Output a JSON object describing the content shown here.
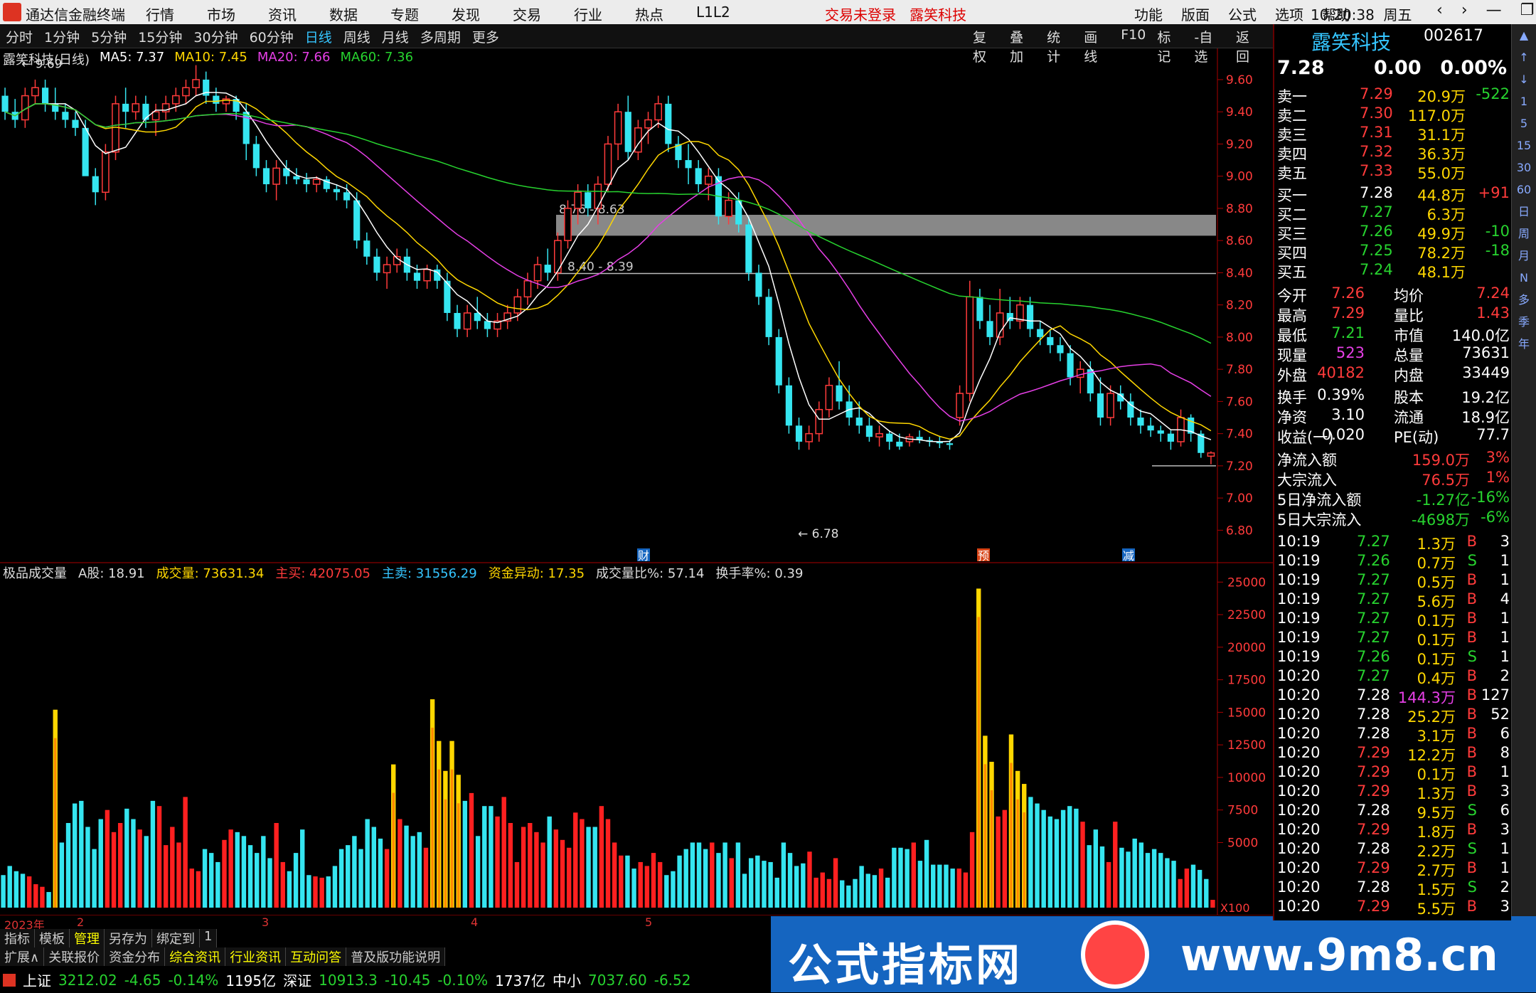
{
  "window": {
    "title": "通达信金融终端",
    "menu": [
      "行情",
      "市场",
      "资讯",
      "数据",
      "专题",
      "发现",
      "交易",
      "行业",
      "热点",
      "L1L2"
    ],
    "login_status": "交易未登录",
    "stock_short": "露笑科技",
    "right_menu": [
      "功能",
      "版面",
      "公式",
      "选项",
      "帮助"
    ],
    "time": "10:20:38",
    "weekday": "周五"
  },
  "toolbar": {
    "periods": [
      "分时",
      "1分钟",
      "5分钟",
      "15分钟",
      "30分钟",
      "60分钟",
      "日线",
      "周线",
      "月线",
      "多周期",
      "更多"
    ],
    "active": "日线",
    "tools": [
      "复权",
      "叠加",
      "统计",
      "画线",
      "F10",
      "标记",
      "-自选",
      "返回"
    ]
  },
  "kline": {
    "title": "露笑科技(日线)",
    "ma": [
      {
        "label": "MA5: 7.37",
        "color": "#ffffff"
      },
      {
        "label": "MA10: 7.45",
        "color": "#ffd700"
      },
      {
        "label": "MA20: 7.66",
        "color": "#e63fe6"
      },
      {
        "label": "MA60: 7.36",
        "color": "#27d32f"
      }
    ],
    "high_label": "9.69",
    "low_label": "6.78",
    "zone_upper_label": "8.76 - 8.63",
    "zone_lower_label": "8.40 - 8.39",
    "markers": [
      "财",
      "预",
      "减"
    ],
    "y_ticks": [
      "9.60",
      "9.40",
      "9.20",
      "9.00",
      "8.80",
      "8.60",
      "8.40",
      "8.20",
      "8.00",
      "7.80",
      "7.60",
      "7.40",
      "7.20",
      "7.00",
      "6.80"
    ]
  },
  "chart_data": [
    {
      "type": "candlestick",
      "title": "露笑科技(日线)",
      "ylim": [
        6.7,
        9.75
      ],
      "ohlc": [
        [
          9.5,
          9.55,
          9.35,
          9.4
        ],
        [
          9.4,
          9.48,
          9.3,
          9.35
        ],
        [
          9.35,
          9.55,
          9.3,
          9.5
        ],
        [
          9.5,
          9.6,
          9.45,
          9.55
        ],
        [
          9.55,
          9.6,
          9.4,
          9.45
        ],
        [
          9.45,
          9.55,
          9.35,
          9.4
        ],
        [
          9.4,
          9.45,
          9.3,
          9.35
        ],
        [
          9.35,
          9.4,
          9.25,
          9.3
        ],
        [
          9.3,
          9.35,
          9.1,
          9.0
        ],
        [
          9.0,
          9.05,
          8.82,
          8.9
        ],
        [
          8.9,
          9.2,
          8.85,
          9.15
        ],
        [
          9.15,
          9.5,
          9.1,
          9.45
        ],
        [
          9.45,
          9.55,
          9.3,
          9.4
        ],
        [
          9.4,
          9.5,
          9.35,
          9.45
        ],
        [
          9.45,
          9.5,
          9.3,
          9.35
        ],
        [
          9.35,
          9.45,
          9.25,
          9.4
        ],
        [
          9.4,
          9.5,
          9.35,
          9.45
        ],
        [
          9.45,
          9.55,
          9.4,
          9.5
        ],
        [
          9.5,
          9.6,
          9.45,
          9.55
        ],
        [
          9.55,
          9.69,
          9.5,
          9.6
        ],
        [
          9.6,
          9.65,
          9.45,
          9.5
        ],
        [
          9.5,
          9.55,
          9.4,
          9.45
        ],
        [
          9.45,
          9.5,
          9.4,
          9.48
        ],
        [
          9.48,
          9.5,
          9.35,
          9.4
        ],
        [
          9.4,
          9.45,
          9.1,
          9.2
        ],
        [
          9.2,
          9.25,
          9.0,
          9.05
        ],
        [
          9.05,
          9.1,
          8.9,
          8.95
        ],
        [
          8.95,
          9.1,
          8.85,
          9.05
        ],
        [
          9.05,
          9.1,
          8.95,
          9.0
        ],
        [
          9.0,
          9.05,
          8.95,
          8.98
        ],
        [
          8.98,
          9.02,
          8.9,
          8.95
        ],
        [
          8.95,
          9.0,
          8.9,
          8.98
        ],
        [
          8.98,
          9.0,
          8.9,
          8.92
        ],
        [
          8.92,
          8.95,
          8.85,
          8.9
        ],
        [
          8.9,
          8.95,
          8.8,
          8.85
        ],
        [
          8.85,
          8.9,
          8.55,
          8.6
        ],
        [
          8.6,
          8.65,
          8.45,
          8.5
        ],
        [
          8.5,
          8.55,
          8.35,
          8.4
        ],
        [
          8.4,
          8.5,
          8.3,
          8.45
        ],
        [
          8.45,
          8.55,
          8.4,
          8.5
        ],
        [
          8.5,
          8.55,
          8.35,
          8.4
        ],
        [
          8.4,
          8.45,
          8.3,
          8.35
        ],
        [
          8.35,
          8.45,
          8.3,
          8.42
        ],
        [
          8.42,
          8.45,
          8.3,
          8.35
        ],
        [
          8.35,
          8.4,
          8.1,
          8.15
        ],
        [
          8.15,
          8.2,
          8.0,
          8.05
        ],
        [
          8.05,
          8.2,
          8.0,
          8.15
        ],
        [
          8.15,
          8.25,
          8.05,
          8.1
        ],
        [
          8.1,
          8.15,
          8.0,
          8.05
        ],
        [
          8.05,
          8.15,
          8.0,
          8.1
        ],
        [
          8.1,
          8.2,
          8.05,
          8.15
        ],
        [
          8.15,
          8.3,
          8.1,
          8.25
        ],
        [
          8.25,
          8.4,
          8.2,
          8.35
        ],
        [
          8.35,
          8.5,
          8.3,
          8.45
        ],
        [
          8.45,
          8.55,
          8.35,
          8.4
        ],
        [
          8.4,
          8.65,
          8.35,
          8.6
        ],
        [
          8.6,
          8.85,
          8.55,
          8.8
        ],
        [
          8.8,
          8.95,
          8.7,
          8.9
        ],
        [
          8.9,
          8.95,
          8.75,
          8.8
        ],
        [
          8.8,
          9.0,
          8.7,
          8.95
        ],
        [
          8.95,
          9.25,
          8.9,
          9.2
        ],
        [
          9.2,
          9.45,
          9.1,
          9.4
        ],
        [
          9.4,
          9.5,
          9.1,
          9.15
        ],
        [
          9.15,
          9.35,
          9.1,
          9.3
        ],
        [
          9.3,
          9.4,
          9.2,
          9.35
        ],
        [
          9.35,
          9.5,
          9.3,
          9.45
        ],
        [
          9.45,
          9.5,
          9.15,
          9.2
        ],
        [
          9.2,
          9.25,
          9.05,
          9.1
        ],
        [
          9.1,
          9.2,
          8.95,
          9.05
        ],
        [
          9.05,
          9.1,
          8.9,
          8.95
        ],
        [
          8.95,
          9.05,
          8.85,
          9.0
        ],
        [
          9.0,
          9.05,
          8.7,
          8.75
        ],
        [
          8.75,
          8.9,
          8.7,
          8.85
        ],
        [
          8.85,
          8.9,
          8.65,
          8.7
        ],
        [
          8.7,
          8.75,
          8.35,
          8.4
        ],
        [
          8.4,
          8.45,
          8.2,
          8.25
        ],
        [
          8.25,
          8.3,
          7.95,
          8.0
        ],
        [
          8.0,
          8.05,
          7.65,
          7.7
        ],
        [
          7.7,
          7.75,
          7.4,
          7.45
        ],
        [
          7.45,
          7.5,
          7.3,
          7.35
        ],
        [
          7.35,
          7.45,
          7.3,
          7.4
        ],
        [
          7.4,
          7.6,
          7.35,
          7.55
        ],
        [
          7.55,
          7.75,
          7.5,
          7.7
        ],
        [
          7.7,
          7.85,
          7.55,
          7.6
        ],
        [
          7.6,
          7.7,
          7.45,
          7.5
        ],
        [
          7.5,
          7.6,
          7.4,
          7.45
        ],
        [
          7.45,
          7.5,
          7.35,
          7.38
        ],
        [
          7.38,
          7.45,
          7.32,
          7.4
        ],
        [
          7.4,
          7.42,
          7.3,
          7.35
        ],
        [
          7.35,
          7.4,
          7.3,
          7.32
        ],
        [
          7.35,
          7.4,
          7.32,
          7.38
        ],
        [
          7.38,
          7.42,
          7.34,
          7.36
        ],
        [
          7.36,
          7.38,
          7.32,
          7.35
        ],
        [
          7.35,
          7.38,
          7.31,
          7.34
        ],
        [
          7.34,
          7.36,
          7.3,
          7.33
        ],
        [
          7.5,
          7.7,
          7.45,
          7.65
        ],
        [
          7.65,
          8.35,
          7.6,
          8.25
        ],
        [
          8.25,
          8.3,
          8.05,
          8.1
        ],
        [
          8.1,
          8.2,
          7.95,
          8.0
        ],
        [
          8.0,
          8.3,
          7.95,
          8.15
        ],
        [
          8.15,
          8.25,
          8.05,
          8.1
        ],
        [
          8.1,
          8.25,
          8.05,
          8.2
        ],
        [
          8.2,
          8.25,
          8.0,
          8.05
        ],
        [
          8.05,
          8.1,
          7.95,
          8.0
        ],
        [
          8.0,
          8.05,
          7.9,
          7.95
        ],
        [
          7.95,
          8.0,
          7.85,
          7.9
        ],
        [
          7.9,
          7.95,
          7.7,
          7.75
        ],
        [
          7.75,
          7.85,
          7.65,
          7.8
        ],
        [
          7.8,
          7.85,
          7.6,
          7.65
        ],
        [
          7.65,
          7.75,
          7.45,
          7.5
        ],
        [
          7.5,
          7.7,
          7.45,
          7.65
        ],
        [
          7.65,
          7.7,
          7.55,
          7.6
        ],
        [
          7.6,
          7.65,
          7.45,
          7.5
        ],
        [
          7.5,
          7.55,
          7.4,
          7.45
        ],
        [
          7.45,
          7.5,
          7.38,
          7.42
        ],
        [
          7.42,
          7.45,
          7.35,
          7.4
        ],
        [
          7.4,
          7.42,
          7.3,
          7.35
        ],
        [
          7.35,
          7.55,
          7.32,
          7.5
        ],
        [
          7.5,
          7.52,
          7.35,
          7.4
        ],
        [
          7.4,
          7.42,
          7.25,
          7.28
        ],
        [
          7.26,
          7.29,
          7.21,
          7.28
        ]
      ]
    },
    {
      "type": "bar",
      "title": "极品成交量",
      "values": [
        2500,
        3200,
        2800,
        2600,
        2400,
        1800,
        1600,
        1200,
        15200,
        5000,
        6500,
        8000,
        8200,
        6200,
        4500,
        6800,
        7500,
        5800,
        6500,
        7600,
        6800,
        6000,
        5500,
        8200,
        7800,
        4800,
        6200,
        5000,
        8500,
        3000,
        2800,
        4500,
        4200,
        3500,
        5200,
        6000,
        5800,
        5500,
        4800,
        4200,
        5500,
        3800,
        6500,
        3500,
        2800,
        4200,
        6000,
        2500,
        2400,
        2300,
        2400,
        3200,
        4500,
        4800,
        5500,
        4500,
        6800,
        6200,
        5300,
        4500,
        11000,
        6800,
        6300,
        5500,
        5800,
        4600,
        16000,
        12800,
        10500,
        12800,
        10200,
        8200,
        8800,
        5500,
        7800,
        7800,
        7000,
        8500,
        6500,
        3500,
        6200,
        6500,
        5800,
        5000,
        7000,
        6000,
        5200,
        4600,
        7300,
        6800,
        6200,
        6200,
        7800,
        6800,
        5000,
        4000,
        4000,
        3000,
        3500,
        3200,
        4200,
        3500,
        2500,
        2800,
        4000,
        4500,
        5000,
        5000,
        4500,
        5000,
        4200,
        5000,
        3800,
        5000,
        2600,
        3800,
        4000,
        3600,
        3500,
        2300,
        5000,
        4200,
        3200,
        3400,
        4300,
        2300,
        2700,
        2200,
        3800,
        2100,
        1700,
        2200,
        3200,
        2600,
        2500,
        3000,
        2300,
        4600,
        4600,
        4500,
        5000,
        3600,
        5200,
        3300,
        3300,
        3300,
        3000,
        3000,
        2700,
        5800,
        24500,
        13200,
        11200,
        7000,
        7500,
        13300,
        10500,
        9500,
        8500,
        8000,
        7500,
        7000,
        6800,
        7500,
        7800,
        7600,
        6600,
        4800,
        6000,
        4700,
        3500,
        6600,
        4600,
        4300,
        5300,
        5000,
        4200,
        4500,
        4200,
        3800,
        3600,
        2200,
        3000,
        3300,
        2900,
        2200,
        600
      ],
      "ylim": [
        0,
        26000
      ]
    }
  ],
  "volume": {
    "title": "极品成交量",
    "a_label": "A股: 18.91",
    "stats": [
      {
        "label": "成交量: 73631.34",
        "color": "#ffd700"
      },
      {
        "label": "主买: 42075.05",
        "color": "#ff3b3b"
      },
      {
        "label": "主卖: 31556.29",
        "color": "#35c5ff"
      },
      {
        "label": "资金异动: 17.35",
        "color": "#ffd700"
      },
      {
        "label": "成交量比%: 57.14",
        "color": "#dddddd"
      },
      {
        "label": "换手率%: 0.39",
        "color": "#dddddd"
      }
    ],
    "y_ticks": [
      "25000",
      "22500",
      "20000",
      "17500",
      "15000",
      "12500",
      "10000",
      "7500",
      "5000"
    ],
    "unit": "X100"
  },
  "dates": [
    "2023年",
    "2",
    "3",
    "4",
    "5"
  ],
  "tabs1": [
    "指标",
    "模板",
    "管理",
    "另存为",
    "绑定到",
    "1"
  ],
  "tabs2": [
    "扩展∧",
    "关联报价",
    "资金分布",
    "综合资讯",
    "行业资讯",
    "互动问答",
    "普及版功能说明"
  ],
  "status": {
    "sh_label": "上证",
    "sh_val": "3212.02",
    "sh_chg": "-4.65",
    "sh_pct": "-0.14%",
    "sh_amt": "1195亿",
    "sz_label": "深证",
    "sz_val": "10913.3",
    "sz_chg": "-10.45",
    "sz_pct": "-0.10%",
    "sz_amt": "1737亿",
    "zx_label": "中小",
    "zx_val": "7037.60",
    "zx_chg": "-6.52"
  },
  "watermark": {
    "text1": "公式指标网",
    "text2": "www.9m8.cn"
  },
  "quote": {
    "name": "露笑科技",
    "code": "002617",
    "price": "7.28",
    "change": "0.00",
    "pct": "0.00%",
    "asks": [
      {
        "l": "卖五",
        "p": "7.33",
        "v": "55.0万",
        "d": ""
      },
      {
        "l": "卖四",
        "p": "7.32",
        "v": "36.3万",
        "d": ""
      },
      {
        "l": "卖三",
        "p": "7.31",
        "v": "31.1万",
        "d": ""
      },
      {
        "l": "卖二",
        "p": "7.30",
        "v": "117.0万",
        "d": ""
      },
      {
        "l": "卖一",
        "p": "7.29",
        "v": "20.9万",
        "d": "-522"
      }
    ],
    "bids": [
      {
        "l": "买一",
        "p": "7.28",
        "v": "44.8万",
        "d": "+91"
      },
      {
        "l": "买二",
        "p": "7.27",
        "v": "6.3万",
        "d": ""
      },
      {
        "l": "买三",
        "p": "7.26",
        "v": "49.9万",
        "d": "-10"
      },
      {
        "l": "买四",
        "p": "7.25",
        "v": "78.2万",
        "d": "-18"
      },
      {
        "l": "买五",
        "p": "7.24",
        "v": "48.1万",
        "d": ""
      }
    ],
    "stats": [
      [
        "今开",
        "7.26",
        "均价",
        "7.24"
      ],
      [
        "最高",
        "7.29",
        "量比",
        "1.43"
      ],
      [
        "最低",
        "7.21",
        "市值",
        "140.0亿"
      ],
      [
        "现量",
        "523",
        "总量",
        "73631"
      ],
      [
        "外盘",
        "40182",
        "内盘",
        "33449"
      ],
      [
        "换手",
        "0.39%",
        "股本",
        "19.2亿"
      ],
      [
        "净资",
        "3.10",
        "流通",
        "18.9亿"
      ],
      [
        "收益(一)",
        "0.020",
        "PE(动)",
        "77.7"
      ]
    ],
    "flows": [
      [
        "净流入额",
        "159.0万",
        "3%"
      ],
      [
        "大宗流入",
        "76.5万",
        "1%"
      ],
      [
        "5日净流入额",
        "-1.27亿",
        "-16%"
      ],
      [
        "5日大宗流入",
        "-4698万",
        "-6%"
      ]
    ],
    "ticks": [
      [
        "10:19",
        "7.27",
        "1.3万",
        "B",
        "3"
      ],
      [
        "10:19",
        "7.26",
        "0.7万",
        "S",
        "1"
      ],
      [
        "10:19",
        "7.27",
        "0.5万",
        "B",
        "1"
      ],
      [
        "10:19",
        "7.27",
        "5.6万",
        "B",
        "4"
      ],
      [
        "10:19",
        "7.27",
        "0.1万",
        "B",
        "1"
      ],
      [
        "10:19",
        "7.27",
        "0.1万",
        "B",
        "1"
      ],
      [
        "10:19",
        "7.26",
        "0.1万",
        "S",
        "1"
      ],
      [
        "10:20",
        "7.27",
        "0.4万",
        "B",
        "2"
      ],
      [
        "10:20",
        "7.28",
        "144.3万",
        "B",
        "127"
      ],
      [
        "10:20",
        "7.28",
        "25.2万",
        "B",
        "52"
      ],
      [
        "10:20",
        "7.28",
        "3.1万",
        "B",
        "6"
      ],
      [
        "10:20",
        "7.29",
        "12.2万",
        "B",
        "8"
      ],
      [
        "10:20",
        "7.29",
        "0.1万",
        "B",
        "1"
      ],
      [
        "10:20",
        "7.29",
        "1.3万",
        "B",
        "3"
      ],
      [
        "10:20",
        "7.28",
        "9.5万",
        "S",
        "6"
      ],
      [
        "10:20",
        "7.29",
        "1.8万",
        "B",
        "3"
      ],
      [
        "10:20",
        "7.28",
        "2.2万",
        "S",
        "1"
      ],
      [
        "10:20",
        "7.29",
        "2.7万",
        "B",
        "1"
      ],
      [
        "10:20",
        "7.28",
        "1.5万",
        "S",
        "2"
      ],
      [
        "10:20",
        "7.29",
        "5.5万",
        "B",
        "3"
      ]
    ]
  },
  "sidebar": [
    "▲",
    "↑",
    "↓",
    "1",
    "5",
    "15",
    "30",
    "60",
    "日",
    "周",
    "月",
    "N",
    "多",
    "季",
    "年"
  ]
}
